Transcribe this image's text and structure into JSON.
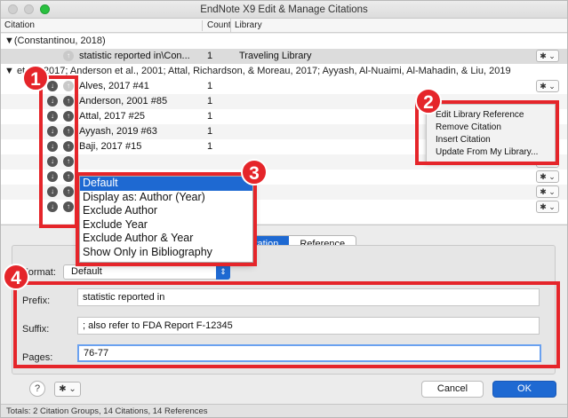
{
  "window": {
    "title": "EndNote X9 Edit & Manage Citations"
  },
  "columns": {
    "citation": "Citation",
    "count": "Count",
    "library": "Library"
  },
  "groups": [
    {
      "label": "▼(Constantinou, 2018)"
    },
    {
      "label": "▼ et al., 2017; Anderson et al., 2001; Attal, Richardson, & Moreau, 2017; Ayyash, Al-Nuaimi, Al-Mahadin, & Liu, 2019"
    }
  ],
  "rows": [
    {
      "text": "statistic reported in\\Con...",
      "count": "1",
      "library": "Traveling Library",
      "gear": "✱ ⌄"
    },
    {
      "text": "Alves, 2017 #41",
      "count": "1"
    },
    {
      "text": "Anderson, 2001 #85",
      "count": "1"
    },
    {
      "text": "Attal, 2017 #25",
      "count": "1"
    },
    {
      "text": "Ayyash, 2019 #63",
      "count": "1"
    },
    {
      "text": "Baji, 2017 #15",
      "count": "1"
    }
  ],
  "library_menu": {
    "items": [
      "Edit Library Reference",
      "Remove Citation",
      "Insert Citation",
      "Update From My Library..."
    ]
  },
  "format_menu": {
    "items": [
      "Default",
      "Display as: Author (Year)",
      "Exclude Author",
      "Exclude Year",
      "Exclude Author & Year",
      "Show Only in Bibliography"
    ]
  },
  "tabs": {
    "citation": "itation",
    "reference": "Reference"
  },
  "form": {
    "format_label": "Format:",
    "format_value": "Default",
    "prefix_label": "Prefix:",
    "prefix_value": "statistic reported in",
    "suffix_label": "Suffix:",
    "suffix_value": "; also refer to FDA Report F-12345",
    "pages_label": "Pages:",
    "pages_value": "76-77"
  },
  "buttons": {
    "help": "?",
    "gear": "✱ ⌄",
    "cancel": "Cancel",
    "ok": "OK"
  },
  "status": "Totals: 2 Citation Groups, 14 Citations, 14 References",
  "callouts": [
    "1",
    "2",
    "3",
    "4"
  ],
  "colors": {
    "accent": "#1e69d2",
    "callout": "#e5252a"
  }
}
